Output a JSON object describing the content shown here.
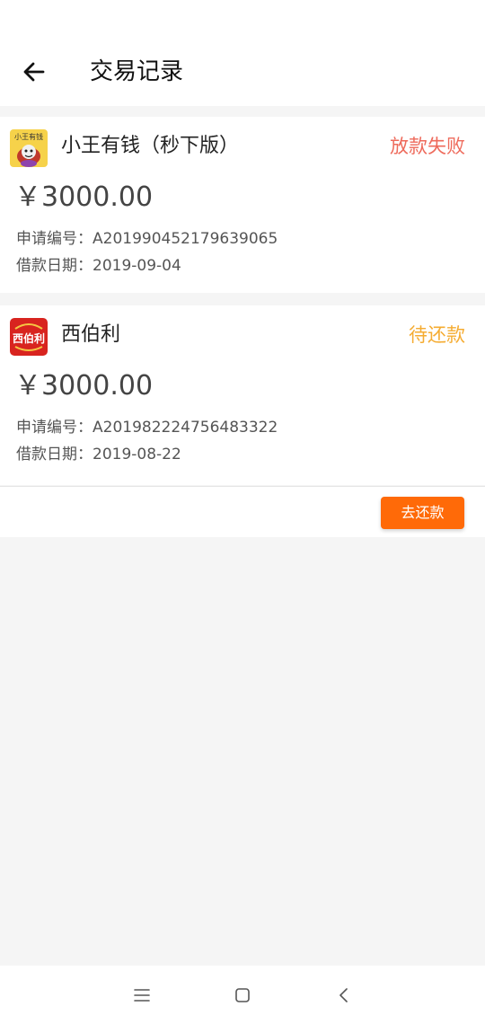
{
  "header": {
    "title": "交易记录",
    "back_icon": "arrow-left-icon"
  },
  "records": [
    {
      "app_name": "小王有钱（秒下版）",
      "logo_text": "小王有钱",
      "status": "放款失败",
      "status_color": "#ee6a5b",
      "amount": "￥3000.00",
      "apply_no": "申请编号：A201990452179639065",
      "loan_date": "借款日期：2019-09-04"
    },
    {
      "app_name": "西伯利",
      "logo_text": "西伯利",
      "status": "待还款",
      "status_color": "#f5ac32",
      "amount": "￥3000.00",
      "apply_no": "申请编号：A201982224756483322",
      "loan_date": "借款日期：2019-08-22"
    }
  ],
  "actions": {
    "repay_label": "去还款",
    "repay_color": "#ff6a08"
  },
  "nav": {
    "menu_icon": "menu-icon",
    "home_icon": "home-icon",
    "back_icon": "back-chevron-icon"
  }
}
